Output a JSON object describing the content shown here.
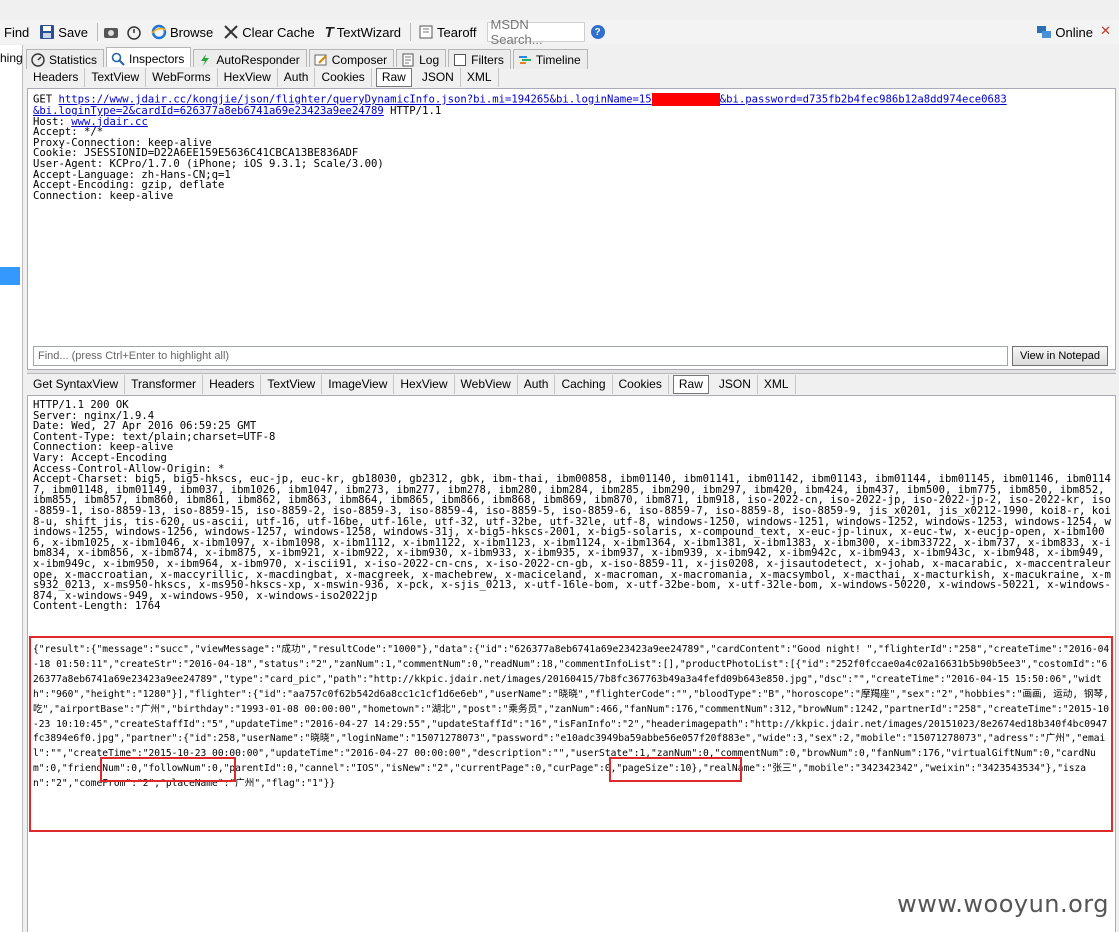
{
  "toolbar": {
    "find": "Find",
    "save": "Save",
    "browse": "Browse",
    "clear_cache": "Clear Cache",
    "text_wizard": "TextWizard",
    "tearoff": "Tearoff",
    "msdn_search": "MSDN Search...",
    "online": "Online",
    "close": "✕"
  },
  "left_strip": {
    "fragment": "hing"
  },
  "main_tabs": [
    "Statistics",
    "Inspectors",
    "AutoResponder",
    "Composer",
    "Log",
    "Filters",
    "Timeline"
  ],
  "request_tabs": [
    "Headers",
    "TextView",
    "WebForms",
    "HexView",
    "Auth",
    "Cookies",
    "Raw",
    "JSON",
    "XML"
  ],
  "request": {
    "method": "GET",
    "url_part1": "https://www.jdair.cc/kongjie/json/flighter/queryDynamicInfo.json?bi.mi=194265&bi.loginName=15",
    "url_part2": "&bi.password=d735fb2b4fec986b12a8dd974ece0683",
    "url_line2": "&bi.loginType=2&cardId=626377a8eb6741a69e23423a9ee24789",
    "protocol": " HTTP/1.1",
    "host_label": "Host: ",
    "host_value": "www.jdair.cc",
    "lines": [
      "Accept: */*",
      "Proxy-Connection: keep-alive",
      "Cookie: JSESSIONID=D22A6EE159E5636C41CBCA13BE836ADF",
      "User-Agent: KCPro/1.7.0 (iPhone; iOS 9.3.1; Scale/3.00)",
      "Accept-Language: zh-Hans-CN;q=1",
      "Accept-Encoding: gzip, deflate",
      "Connection: keep-alive"
    ]
  },
  "find_placeholder": "Find... (press Ctrl+Enter to highlight all)",
  "view_in_notepad": "View in Notepad",
  "response_tabs": [
    "Get SyntaxView",
    "Transformer",
    "Headers",
    "TextView",
    "ImageView",
    "HexView",
    "WebView",
    "Auth",
    "Caching",
    "Cookies",
    "Raw",
    "JSON",
    "XML"
  ],
  "response_headers": [
    "HTTP/1.1 200 OK",
    "Server: nginx/1.9.4",
    "Date: Wed, 27 Apr 2016 06:59:25 GMT",
    "Content-Type: text/plain;charset=UTF-8",
    "Connection: keep-alive",
    "Vary: Accept-Encoding",
    "Access-Control-Allow-Origin: *",
    "Accept-Charset: big5, big5-hkscs, euc-jp, euc-kr, gb18030, gb2312, gbk, ibm-thai, ibm00858, ibm01140, ibm01141, ibm01142, ibm01143, ibm01144, ibm01145, ibm01146, ibm01147, ibm01148, ibm01149, ibm037, ibm1026, ibm1047, ibm273, ibm277, ibm278, ibm280, ibm284, ibm285, ibm290, ibm297, ibm420, ibm424, ibm437, ibm500, ibm775, ibm850, ibm852, ibm855, ibm857, ibm860, ibm861, ibm862, ibm863, ibm864, ibm865, ibm866, ibm868, ibm869, ibm870, ibm871, ibm918, iso-2022-cn, iso-2022-jp, iso-2022-jp-2, iso-2022-kr, iso-8859-1, iso-8859-13, iso-8859-15, iso-8859-2, iso-8859-3, iso-8859-4, iso-8859-5, iso-8859-6, iso-8859-7, iso-8859-8, iso-8859-9, jis_x0201, jis_x0212-1990, koi8-r, koi8-u, shift_jis, tis-620, us-ascii, utf-16, utf-16be, utf-16le, utf-32, utf-32be, utf-32le, utf-8, windows-1250, windows-1251, windows-1252, windows-1253, windows-1254, windows-1255, windows-1256, windows-1257, windows-1258, windows-31j, x-big5-hkscs-2001, x-big5-solaris, x-compound_text, x-euc-jp-linux, x-euc-tw, x-eucjp-open, x-ibm1006, x-ibm1025, x-ibm1046, x-ibm1097, x-ibm1098, x-ibm1112, x-ibm1122, x-ibm1123, x-ibm1124, x-ibm1364, x-ibm1381, x-ibm1383, x-ibm300, x-ibm33722, x-ibm737, x-ibm833, x-ibm834, x-ibm856, x-ibm874, x-ibm875, x-ibm921, x-ibm922, x-ibm930, x-ibm933, x-ibm935, x-ibm937, x-ibm939, x-ibm942, x-ibm942c, x-ibm943, x-ibm943c, x-ibm948, x-ibm949, x-ibm949c, x-ibm950, x-ibm964, x-ibm970, x-iscii91, x-iso-2022-cn-cns, x-iso-2022-cn-gb, x-iso-8859-11, x-jis0208, x-jisautodetect, x-johab, x-macarabic, x-maccentraleurope, x-maccroatian, x-maccyrillic, x-macdingbat, x-macgreek, x-machebrew, x-maciceland, x-macroman, x-macromania, x-macsymbol, x-macthai, x-macturkish, x-macukraine, x-ms932_0213, x-ms950-hkscs, x-ms950-hkscs-xp, x-mswin-936, x-pck, x-sjis_0213, x-utf-16le-bom, x-utf-32be-bom, x-utf-32le-bom, x-windows-50220, x-windows-50221, x-windows-874, x-windows-949, x-windows-950, x-windows-iso2022jp",
    "Content-Length: 1764"
  ],
  "response_body": "{\"result\":{\"message\":\"succ\",\"viewMessage\":\"成功\",\"resultCode\":\"1000\"},\"data\":{\"id\":\"626377a8eb6741a69e23423a9ee24789\",\"cardContent\":\"Good night! \",\"flighterId\":\"258\",\"createTime\":\"2016-04-18 01:50:11\",\"createStr\":\"2016-04-18\",\"status\":\"2\",\"zanNum\":1,\"commentNum\":0,\"readNum\":18,\"commentInfoList\":[],\"productPhotoList\":[{\"id\":\"252f0fccae0a4c02a16631b5b90b5ee3\",\"costomId\":\"626377a8eb6741a69e23423a9ee24789\",\"type\":\"card_pic\",\"path\":\"http://kkpic.jdair.net/images/20160415/7b8fc367763b49a3a4fefd09b643e850.jpg\",\"dsc\":\"\",\"createTime\":\"2016-04-15 15:50:06\",\"width\":\"960\",\"height\":\"1280\"}],\"flighter\":{\"id\":\"aa757c0f62b542d6a8cc1c1cf1d6e6eb\",\"userName\":\"晓晓\",\"flighterCode\":\"\",\"bloodType\":\"B\",\"horoscope\":\"摩羯座\",\"sex\":\"2\",\"hobbies\":\"画画, 运动, 钢琴, 吃\",\"airportBase\":\"广州\",\"birthday\":\"1993-01-08 00:00:00\",\"hometown\":\"湖北\",\"post\":\"乘务员\",\"zanNum\":466,\"fanNum\":176,\"commentNum\":312,\"browNum\":1242,\"partnerId\":\"258\",\"createTime\":\"2015-10-23 10:10:45\",\"createStaffId\":\"5\",\"updateTime\":\"2016-04-27 14:29:55\",\"updateStaffId\":\"16\",\"isFanInfo\":\"2\",\"headerimagepath\":\"http://kkpic.jdair.net/images/20151023/8e2674ed18b340f4bc0947fc3894e6f0.jpg\",\"partner\":{\"id\":258,\"userName\":\"晓晓\",\"loginName\":\"15071278073\",\"password\":\"e10adc3949ba59abbe56e057f20f883e\",\"wide\":3,\"sex\":2,\"mobile\":\"15071278073\",\"adress\":\"广州\",\"email\":\"\",\"createTime\":\"2015-10-23 00:00:00\",\"updateTime\":\"2016-04-27 00:00:00\",\"description\":\"\",\"userState\":1,\"zanNum\":0,\"commentNum\":0,\"browNum\":0,\"fanNum\":176,\"virtualGiftNum\":0,\"cardNum\":0,\"friendNum\":0,\"followNum\":0,\"parentId\":0,\"cannel\":\"IOS\",\"isNew\":\"2\",\"currentPage\":0,\"curPage\":0,\"pageSize\":10},\"realName\":\"张三\",\"mobile\":\"342342342\",\"weixin\":\"3423543534\"},\"iszan\":\"2\",\"comeFrom\":\"2\",\"placeName\":\"广州\",\"flag\":\"1\"}}",
  "watermark": "www.wooyun.org",
  "colors": {
    "highlight_box": "#e02a2a",
    "redaction": "#ff0000",
    "selection": "#3399ff"
  }
}
